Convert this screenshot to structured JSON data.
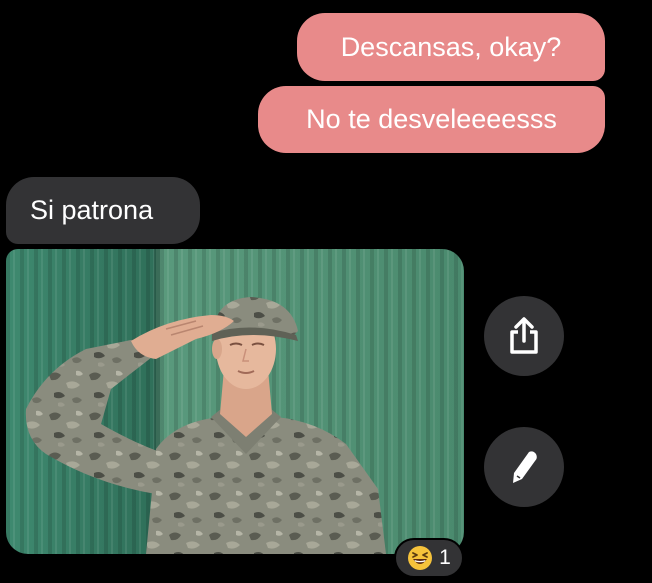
{
  "messages": {
    "outgoing_1": "Descansas, okay?",
    "outgoing_2": "No te desveleeeesss",
    "incoming_1": "Si patrona"
  },
  "photo": {
    "icon": "saluting-soldier-photo"
  },
  "actions": {
    "share_icon": "share-icon",
    "edit_icon": "pencil-icon"
  },
  "reaction": {
    "emoji_icon": "grinning-squinting-face-icon",
    "count": "1"
  },
  "colors": {
    "background": "#000000",
    "outgoing_bubble": "#e88a8a",
    "incoming_bubble": "#333335",
    "text": "#ffffff"
  }
}
